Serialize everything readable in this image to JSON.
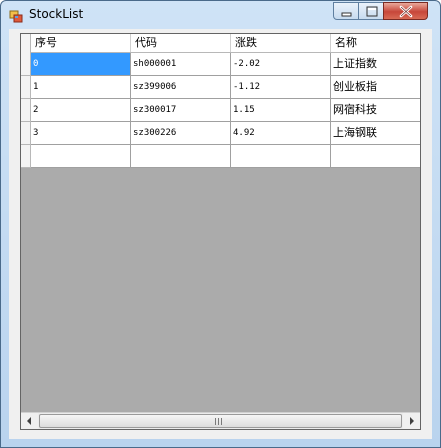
{
  "window": {
    "title": "StockList"
  },
  "icons": {
    "app": "app-window-icon",
    "minimize": "minimize-icon",
    "maximize": "maximize-icon",
    "close": "close-icon",
    "scroll_left": "arrow-left-icon",
    "scroll_right": "arrow-right-icon",
    "grip": "scroll-grip-icon"
  },
  "grid": {
    "columns": [
      "序号",
      "代码",
      "涨跌",
      "名称"
    ],
    "rows": [
      [
        "0",
        "sh000001",
        "-2.02",
        "上证指数"
      ],
      [
        "1",
        "sz399006",
        "-1.12",
        "创业板指"
      ],
      [
        "2",
        "sz300017",
        "1.15",
        "网宿科技"
      ],
      [
        "3",
        "sz300226",
        "4.92",
        "上海钢联"
      ],
      [
        "",
        "",
        "",
        ""
      ]
    ],
    "selected_cell": "0"
  },
  "colors": {
    "selection": "#3399ff",
    "grid_background": "#ababab",
    "close_button": "#c7473a"
  }
}
